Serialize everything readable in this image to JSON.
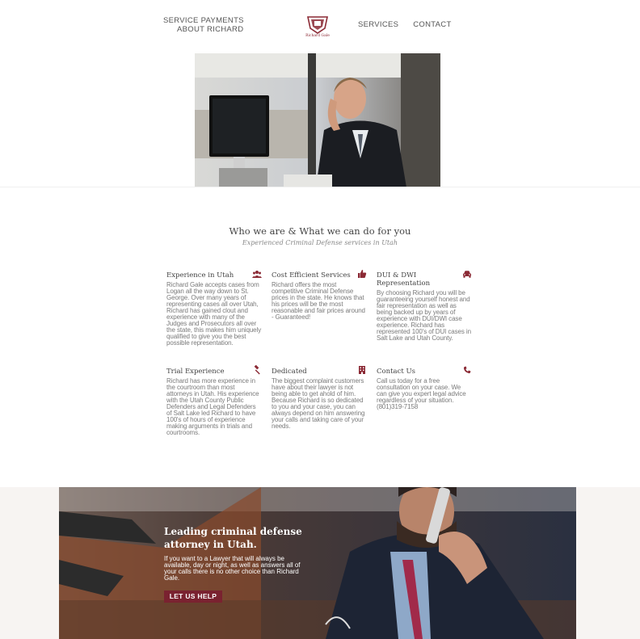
{
  "nav": {
    "left_items": [
      "SERVICE PAYMENTS",
      "ABOUT RICHARD"
    ],
    "right_items": [
      "SERVICES",
      "CONTACT"
    ],
    "logo_text": "Richard Gale"
  },
  "section": {
    "title": "Who we are & What we can do for you",
    "subtitle": "Experienced Criminal Defense services in Utah"
  },
  "features": [
    {
      "title": "Experience in Utah",
      "icon": "users-icon",
      "text": "Richard Gale accepts cases from Logan all the way down to St. George. Over many years of representing cases all over Utah, Richard has gained clout and experience with many of the Judges and Prosecutors all over the state, this makes him uniquely qualified to give you the best possible representation."
    },
    {
      "title": "Cost Efficient Services",
      "icon": "thumbs-up-icon",
      "text": "Richard offers the most competitive Criminal Defense prices in the state. He knows that his prices will be the most reasonable and fair prices around - Guaranteed!"
    },
    {
      "title": "DUI & DWI Representation",
      "icon": "car-icon",
      "text": "By choosing Richard you will be guaranteeing yourself honest and fair representation as well as being backed up by years of experience with DUI/DWI case experience. Richard has represented 100's of DUI cases in Salt Lake and Utah County."
    },
    {
      "title": "Trial Experience",
      "icon": "gavel-icon",
      "text": "Richard has more experience in the courtroom than most attorneys in Utah. His experience with the Utah County Public Defenders and Legal Defenders of Salt Lake led Richard to have 100's of hours of experience making arguments in trials and courtrooms."
    },
    {
      "title": "Dedicated",
      "icon": "building-icon",
      "text": "The biggest complaint customers have about their lawyer is not being able to get ahold of him. Because Richard is so dedicated to you and your case, you can always depend on him answering your calls and taking care of your needs."
    },
    {
      "title": "Contact Us",
      "icon": "phone-icon",
      "text": "Call us today for a free consultation on your case. We can give you expert legal advice regardless of your situation. (801)319-7158"
    }
  ],
  "banner": {
    "title": "Leading criminal defense attorney in Utah.",
    "text": "If you want to a Lawyer that will always be available, day or night, as well as answers all of your calls there is no other choice than Richard Gale.",
    "cta": "LET US HELP"
  },
  "colors": {
    "accent": "#7a2230",
    "icon": "#8b2a35"
  }
}
